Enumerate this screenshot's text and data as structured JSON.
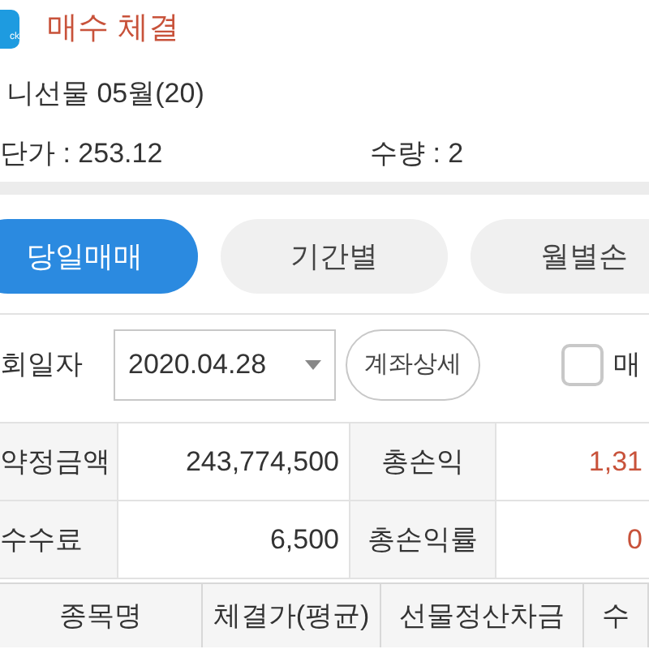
{
  "notification": {
    "app_icon_label": "ck",
    "title": "매수 체결",
    "product": "니선물 05월(20)",
    "price": "단가 : 253.12",
    "quantity": "수량 : 2"
  },
  "tabs": [
    {
      "label": "당일매매",
      "selected": true
    },
    {
      "label": "기간별",
      "selected": false
    },
    {
      "label": "월별손",
      "selected": false
    }
  ],
  "filter": {
    "label": "회일자",
    "date": "2020.04.28",
    "detail_button": "계좌상세",
    "checkbox": {
      "label": "매",
      "checked": false
    }
  },
  "summary": [
    {
      "label": "약정금액",
      "value": "243,774,500",
      "label_2": "총손익",
      "value_2": "1,31"
    },
    {
      "label": "수수료",
      "value": "6,500",
      "label_2": "총손익률",
      "value_2": "0"
    }
  ],
  "table": {
    "columns": [
      "종목명",
      "체결가(평균)",
      "선물정산차금",
      "수"
    ]
  }
}
